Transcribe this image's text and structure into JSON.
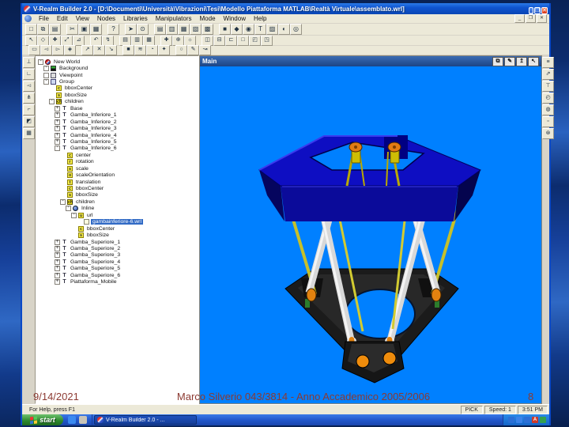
{
  "colors": {
    "viewport_bg": "#0080ff",
    "selection": "#316ac5",
    "footer_text": "#8c3a32",
    "titlebar_blue": "#0f54d0",
    "taskbar_blue": "#2258cc",
    "platform_blue": "#0e0ec2",
    "leg_white": "#d8d8d8",
    "rod_yellow": "#c6c02a",
    "joint_orange": "#e2820f",
    "base_black": "#1b1b1b"
  },
  "window": {
    "title": "V-Realm Builder 2.0 - [D:\\Documenti\\Università\\Vibrazioni\\Tesi\\Modello Piattaforma MATLAB\\Realtà Virtuale\\assemblato.wrl]",
    "buttons": [
      {
        "g": "_",
        "name": "minimize-button"
      },
      {
        "g": "❐",
        "name": "maximize-button"
      },
      {
        "g": "✕",
        "name": "close-button"
      }
    ],
    "mdi_buttons": [
      {
        "g": "_",
        "name": "mdi-minimize-button"
      },
      {
        "g": "❐",
        "name": "mdi-restore-button"
      },
      {
        "g": "✕",
        "name": "mdi-close-button"
      }
    ]
  },
  "menus": [
    "File",
    "Edit",
    "View",
    "Nodes",
    "Libraries",
    "Manipulators",
    "Mode",
    "Window",
    "Help"
  ],
  "toolbars": {
    "row1": [
      {
        "g": "□",
        "name": "new-button"
      },
      {
        "g": "⧉",
        "name": "open-button"
      },
      {
        "g": "▤",
        "name": "save-button"
      },
      {
        "g": "✂",
        "name": "cut-button",
        "sep": true
      },
      {
        "g": "▣",
        "name": "copy-button"
      },
      {
        "g": "▦",
        "name": "paste-button"
      },
      {
        "g": "?",
        "name": "help-button",
        "sep": true
      },
      {
        "g": "➤",
        "name": "route-button",
        "sep": true
      },
      {
        "g": "⊙",
        "name": "zoom-button"
      },
      {
        "g": "▤",
        "name": "view-grid-button",
        "sep": true
      },
      {
        "g": "▥",
        "name": "view-rows-button"
      },
      {
        "g": "▦",
        "name": "view-cells-button"
      },
      {
        "g": "▧",
        "name": "view-diag-button"
      },
      {
        "g": "▩",
        "name": "view-dense-button"
      },
      {
        "g": "■",
        "name": "material-button",
        "sep": true
      },
      {
        "g": "◆",
        "name": "shape-button"
      },
      {
        "g": "◉",
        "name": "light-button"
      },
      {
        "g": "T",
        "name": "text-node-button"
      },
      {
        "g": "▨",
        "name": "texture-button"
      },
      {
        "g": "◐",
        "name": "shading-button"
      },
      {
        "g": "◎",
        "name": "sphere-button"
      }
    ],
    "row2": [
      {
        "g": "↖",
        "name": "select-tool-button"
      },
      {
        "g": "◇",
        "name": "rotate-tool-button"
      },
      {
        "g": "✚",
        "name": "move-tool-button"
      },
      {
        "g": "⤢",
        "name": "scale-tool-button"
      },
      {
        "g": "⊿",
        "name": "shear-tool-button"
      },
      {
        "g": "↶",
        "name": "undo-button",
        "sep": true
      },
      {
        "g": "↯",
        "name": "lightning-button"
      },
      {
        "g": "▤",
        "name": "world-doc1-button",
        "sep": true
      },
      {
        "g": "▥",
        "name": "world-doc2-button"
      },
      {
        "g": "▦",
        "name": "world-doc3-button"
      },
      {
        "g": "✚",
        "name": "pan-world-button",
        "sep": true
      },
      {
        "g": "⊕",
        "name": "globe-button"
      },
      {
        "g": "☼",
        "name": "lamp-button"
      },
      {
        "g": "◫",
        "name": "layout-split-button",
        "sep": true
      },
      {
        "g": "⊟",
        "name": "layout-hsplit-button"
      },
      {
        "g": "⊏",
        "name": "layout-left-button"
      },
      {
        "g": "□",
        "name": "layout-single-button"
      },
      {
        "g": "◰",
        "name": "layout-quad-button"
      },
      {
        "g": "◳",
        "name": "layout-corner-button"
      }
    ],
    "row3": [
      {
        "g": "▭",
        "name": "camera-button"
      },
      {
        "g": "◅",
        "name": "speaker-left-button"
      },
      {
        "g": "▻",
        "name": "speaker-right-button"
      },
      {
        "g": "◈",
        "name": "gem-button"
      },
      {
        "g": "↗",
        "name": "fly-button",
        "sep": true
      },
      {
        "g": "✕",
        "name": "stop-button"
      },
      {
        "g": "↘",
        "name": "land-button"
      },
      {
        "g": "■",
        "name": "solid-button",
        "sep": true
      },
      {
        "g": "≋",
        "name": "wave-button"
      },
      {
        "g": "◔",
        "name": "clock-button"
      },
      {
        "g": "✦",
        "name": "star-button"
      },
      {
        "g": "○",
        "name": "circle-button",
        "sep": true
      },
      {
        "g": "✎",
        "name": "pencil-button"
      },
      {
        "g": "↝",
        "name": "path-button"
      }
    ],
    "vleft": [
      {
        "g": "⊥",
        "name": "view-bottom-button"
      },
      {
        "g": "∟",
        "name": "view-corner-button"
      },
      {
        "g": "◅",
        "name": "view-left-button"
      },
      {
        "g": "⋔",
        "name": "view-fork-button"
      },
      {
        "g": "⌐",
        "name": "view-top-button"
      },
      {
        "g": "◩",
        "name": "view-iso-button"
      },
      {
        "g": "▦",
        "name": "view-grid-small-button"
      }
    ],
    "vright": [
      {
        "g": "≡",
        "name": "nav-list-button"
      },
      {
        "g": "⇗",
        "name": "nav-fly-button"
      },
      {
        "g": "⊤",
        "name": "nav-top-button"
      },
      {
        "g": "◴",
        "name": "nav-orbit-button"
      },
      {
        "g": "◍",
        "name": "nav-examine-button"
      },
      {
        "g": "▫",
        "name": "nav-reset-button"
      },
      {
        "g": "⊛",
        "name": "nav-seek-button"
      }
    ]
  },
  "viewport": {
    "title": "Main",
    "buttons": [
      {
        "g": "⧉",
        "name": "viewport-tree-button"
      },
      {
        "g": "✎",
        "name": "viewport-edit-button"
      },
      {
        "g": "↥",
        "name": "viewport-pan-button"
      },
      {
        "g": "↖",
        "name": "viewport-select-button"
      }
    ]
  },
  "tree": {
    "items": [
      {
        "level": 0,
        "label": "New World",
        "icon": "world",
        "mark": "-"
      },
      {
        "level": 1,
        "label": "Background",
        "icon": "bg",
        "mark": "-"
      },
      {
        "level": 1,
        "label": "Viewpoint",
        "icon": "vp",
        "mark": "o"
      },
      {
        "level": 1,
        "label": "Group",
        "icon": "group",
        "mark": "-"
      },
      {
        "level": 2,
        "label": "bboxCenter",
        "icon": "field",
        "letter": "c"
      },
      {
        "level": 2,
        "label": "bboxSize",
        "icon": "field",
        "letter": "s"
      },
      {
        "level": 2,
        "label": "children",
        "icon": "children",
        "letter": "ch",
        "mark": "-"
      },
      {
        "level": 3,
        "label": "Base",
        "icon": "transform",
        "letter": "T",
        "mark": "+"
      },
      {
        "level": 3,
        "label": "Gamba_Inferiore_1",
        "icon": "transform",
        "letter": "T",
        "mark": "+"
      },
      {
        "level": 3,
        "label": "Gamba_Inferiore_2",
        "icon": "transform",
        "letter": "T",
        "mark": "+"
      },
      {
        "level": 3,
        "label": "Gamba_Inferiore_3",
        "icon": "transform",
        "letter": "T",
        "mark": "+"
      },
      {
        "level": 3,
        "label": "Gamba_Inferiore_4",
        "icon": "transform",
        "letter": "T",
        "mark": "+"
      },
      {
        "level": 3,
        "label": "Gamba_Inferiore_5",
        "icon": "transform",
        "letter": "T",
        "mark": "+"
      },
      {
        "level": 3,
        "label": "Gamba_Inferiore_6",
        "icon": "transform",
        "letter": "T",
        "mark": "-"
      },
      {
        "level": 4,
        "label": "center",
        "icon": "field",
        "letter": "c"
      },
      {
        "level": 4,
        "label": "rotation",
        "icon": "field",
        "letter": "r"
      },
      {
        "level": 4,
        "label": "scale",
        "icon": "field",
        "letter": "s"
      },
      {
        "level": 4,
        "label": "scaleOrientation",
        "icon": "field",
        "letter": "o"
      },
      {
        "level": 4,
        "label": "translation",
        "icon": "field",
        "letter": "t"
      },
      {
        "level": 4,
        "label": "bboxCenter",
        "icon": "field",
        "letter": "c"
      },
      {
        "level": 4,
        "label": "bboxSize",
        "icon": "field",
        "letter": "s"
      },
      {
        "level": 4,
        "label": "children",
        "icon": "children",
        "letter": "ch",
        "mark": "-"
      },
      {
        "level": 5,
        "label": "Inline",
        "icon": "inline",
        "mark": "-"
      },
      {
        "level": 6,
        "label": "url",
        "icon": "field",
        "letter": "u",
        "mark": "-"
      },
      {
        "level": 7,
        "label": "gambainferiore-6.wrl",
        "icon": "file",
        "selected": true
      },
      {
        "level": 6,
        "label": "bboxCenter",
        "icon": "field",
        "letter": "c"
      },
      {
        "level": 6,
        "label": "bboxSize",
        "icon": "field",
        "letter": "s"
      },
      {
        "level": 3,
        "label": "Gamba_Superiore_1",
        "icon": "transform",
        "letter": "T",
        "mark": "+"
      },
      {
        "level": 3,
        "label": "Gamba_Superiore_2",
        "icon": "transform",
        "letter": "T",
        "mark": "+"
      },
      {
        "level": 3,
        "label": "Gamba_Superiore_3",
        "icon": "transform",
        "letter": "T",
        "mark": "+"
      },
      {
        "level": 3,
        "label": "Gamba_Superiore_4",
        "icon": "transform",
        "letter": "T",
        "mark": "+"
      },
      {
        "level": 3,
        "label": "Gamba_Superiore_5",
        "icon": "transform",
        "letter": "T",
        "mark": "+"
      },
      {
        "level": 3,
        "label": "Gamba_Superiore_6",
        "icon": "transform",
        "letter": "T",
        "mark": "+"
      },
      {
        "level": 3,
        "label": "Piattaforma_Mobile",
        "icon": "transform",
        "letter": "T",
        "mark": "+"
      }
    ]
  },
  "statusbar": {
    "help": "For Help, press F1",
    "cells": [
      "PICK",
      "Speed: 1",
      "3:51 PM"
    ]
  },
  "taskbar": {
    "start_label": "start",
    "quick_launch": [
      {
        "color": "#3a8af0",
        "name": "quicklaunch-browser-icon"
      },
      {
        "color": "#c8c4b8",
        "name": "quicklaunch-desktop-icon"
      }
    ],
    "task_label": "V-Realm Builder 2.0 - ...",
    "tray_icons": [
      {
        "color": "#2b6fd6",
        "label": "",
        "name": "tray-icon-1"
      },
      {
        "color": "#3b82e8",
        "label": "",
        "name": "tray-icon-2"
      },
      {
        "color": "#2b6fd6",
        "label": "",
        "name": "tray-icon-3"
      },
      {
        "color": "#cc3a2a",
        "label": "A",
        "name": "tray-language-icon"
      },
      {
        "color": "#33a050",
        "label": "",
        "name": "tray-icon-5"
      }
    ]
  },
  "slide": {
    "date": "9/14/2021",
    "footer": "Marco Silverio 043/3814 - Anno Accademico 2005/2006",
    "page_number": "8"
  }
}
